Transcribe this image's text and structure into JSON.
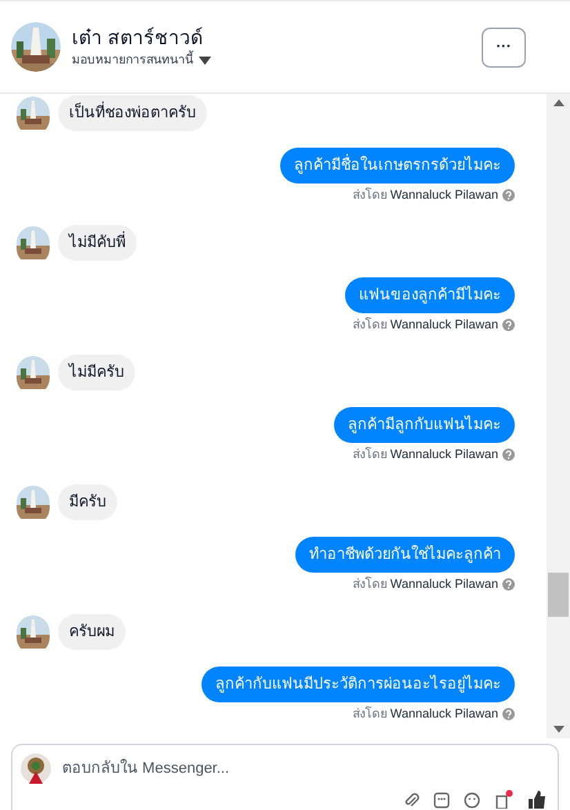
{
  "header": {
    "name": "เต๋า สตาร์ชาวด์",
    "subtitle": "มอบหมายการสนทนานี้",
    "more": "···"
  },
  "messages": [
    {
      "kind": "incoming",
      "text": "เป็นที่ชองพ่อตาครับ"
    },
    {
      "kind": "outgoing",
      "text": "ลูกค้ามีชื่อในเกษตรกรด้วยไมคะ",
      "sent_by": "ส่งโดย **Wannaluck Pilawan**"
    },
    {
      "kind": "incoming",
      "text": "ไม่มีคับพี่"
    },
    {
      "kind": "outgoing",
      "text": "แฟนของลูกค้ามีไมคะ",
      "sent_by": "ส่งโดย **Wannaluck Pilawan**"
    },
    {
      "kind": "incoming",
      "text": "ไม่มีครับ"
    },
    {
      "kind": "outgoing",
      "text": "ลูกค้ามีลูกกับแฟนไมคะ",
      "sent_by": "ส่งโดย **Wannaluck Pilawan**"
    },
    {
      "kind": "incoming",
      "text": "มีครับ"
    },
    {
      "kind": "outgoing",
      "text": "ทำอาชีพด้วยกันใช่ไมคะลูกค้า",
      "sent_by": "ส่งโดย **Wannaluck Pilawan**"
    },
    {
      "kind": "incoming",
      "text": "ครับผม"
    },
    {
      "kind": "outgoing",
      "text": "ลูกค้ากับแฟนมีประวัติการผ่อนอะไรอยู่ไมคะ",
      "sent_by": "ส่งโดย **Wannaluck Pilawan**"
    }
  ],
  "composer": {
    "placeholder": "ตอบกลับใน Messenger..."
  }
}
